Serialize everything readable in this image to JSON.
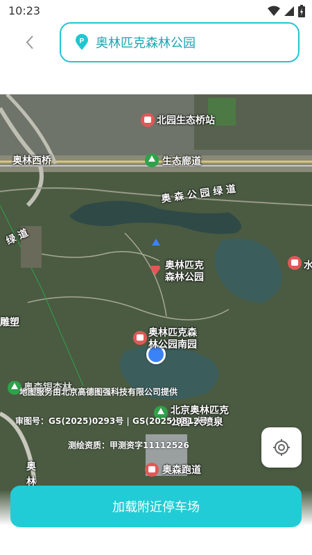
{
  "status_bar": {
    "time": "10:23"
  },
  "search": {
    "value": "奥林匹克森林公园"
  },
  "map": {
    "labels": {
      "beiyuan": "北园生态桥站",
      "aolin_west_bridge": "奥林西桥",
      "eco_corridor": "生态廊道",
      "greenway": "奥 森 公 园 绿 道",
      "greenway_left": "绿 道",
      "olympic_park_1": "奥林匹克",
      "olympic_park_2": "森林公园",
      "south_park_1": "奥林匹克森",
      "south_park_2": "林公园南园",
      "sculpture": "雕塑",
      "water": "水",
      "aosen_sign": "奥森银杏林",
      "fountain_1": "北京奥林匹克",
      "fountain_2": "公园-大喷泉",
      "running_track": "奥森跑道",
      "ao_1": "奥",
      "ao_2": "林"
    },
    "attribution": {
      "provider": "地图服务由北京高德图强科技有限公司提供",
      "review": "审图号：GS(2025)0293号 | GS(2025)0812号",
      "survey": "测绘资质：甲测资字11112526"
    }
  },
  "actions": {
    "load_parking": "加载附近停车场"
  },
  "colors": {
    "accent": "#22ccd6",
    "poi_red": "#e25757",
    "poi_green": "#2fa24a",
    "user_dot": "#3b82f6"
  }
}
